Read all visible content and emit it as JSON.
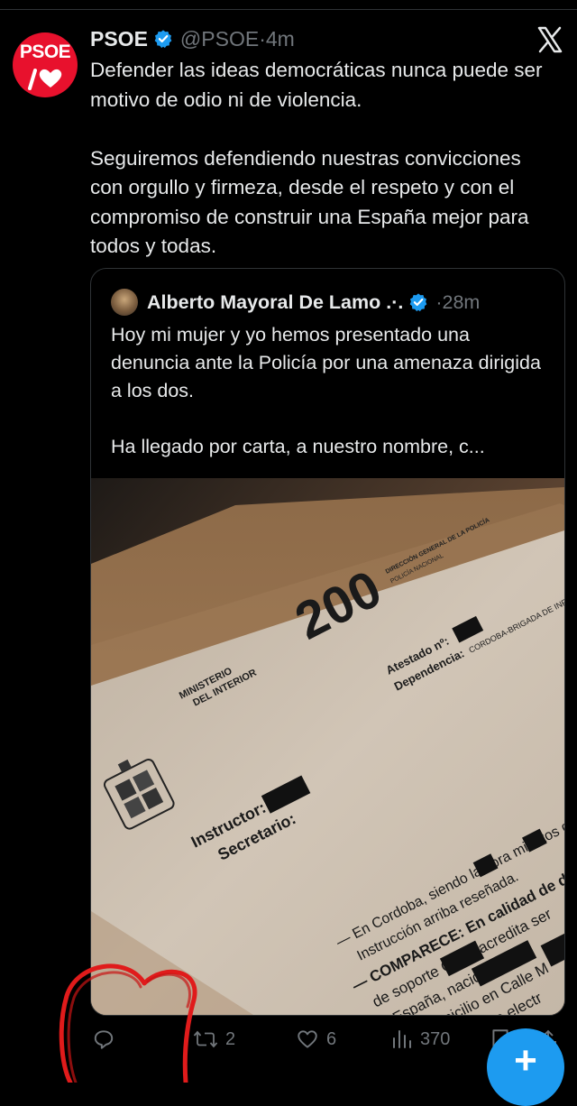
{
  "post": {
    "author_name": "PSOE",
    "handle": "@PSOE",
    "time": "4m",
    "avatar_text": "PSOE",
    "paragraphs": [
      "Defender las ideas democráticas nunca puede ser motivo de odio ni de violencia.",
      "Seguiremos defendiendo nuestras convicciones con orgullo y firmeza, desde el respeto y con el compromiso de construir una España mejor para todos y todas."
    ]
  },
  "quoted_post": {
    "author_name": "Alberto Mayoral De Lamo .·.",
    "time": "28m",
    "paragraphs": [
      "Hoy mi mujer y yo hemos presentado una denuncia ante la Policía por una amenaza dirigida a los dos.",
      "Ha llegado por carta, a nuestro nombre, c..."
    ],
    "photo_text": {
      "logo_number": "200",
      "direccion": "DIRECCIÓN GENERAL DE LA POLICÍA",
      "policia": "POLICÍA NACIONAL",
      "atestado": "Atestado nº:",
      "dependencia_label": "Dependencia:",
      "dependencia_value": "CORDOBA-BRIGADA DE INFORMACION",
      "ministerio_1": "MINISTERIO",
      "ministerio_2": "DEL INTERIOR",
      "instructor": "Instructor:",
      "secretario": "Secretario:",
      "line_1": "— En Cordoba, siendo la      hora      minutos del día",
      "line_2": "Instrucción arriba reseñada.",
      "line_3": "— COMPARECE: En calidad de denunciante",
      "line_4": "de soporte CNNI       acredita ser",
      "line_5": "España, nacido",
      "line_6": "domicilio en Calle M",
      "line_7": "correo electr"
    }
  },
  "actions": {
    "replies": "",
    "reposts": "2",
    "likes": "6",
    "views": "370"
  },
  "fab": {
    "label": "+"
  },
  "colors": {
    "accent": "#1d9bf0",
    "brand": "#e8112d",
    "muted": "#71767b"
  }
}
